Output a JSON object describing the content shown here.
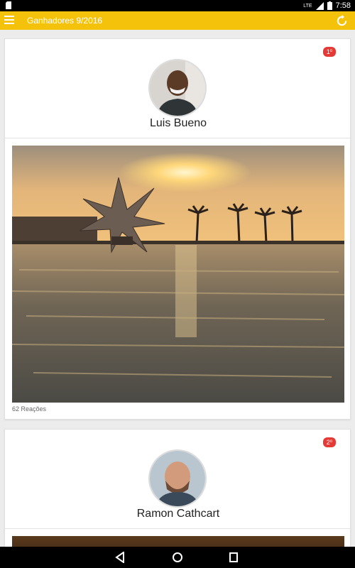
{
  "status_bar": {
    "time": "7:58",
    "network": "LTE",
    "icons": [
      "sim-icon",
      "lte-signal-icon",
      "battery-icon"
    ]
  },
  "app_bar": {
    "title": "Ganhadores 9/2016",
    "left_icon": "menu-icon",
    "right_icon": "refresh-icon",
    "color": "#f5c20b"
  },
  "winners": [
    {
      "rank": "1º",
      "name": "Luis Bueno",
      "reactions": "62 Reações"
    },
    {
      "rank": "2º",
      "name": "Ramon Cathcart"
    }
  ],
  "colors": {
    "badge": "#e53935",
    "background": "#ececec"
  },
  "nav_bar": {
    "buttons": [
      "back-icon",
      "home-icon",
      "recents-icon"
    ]
  }
}
